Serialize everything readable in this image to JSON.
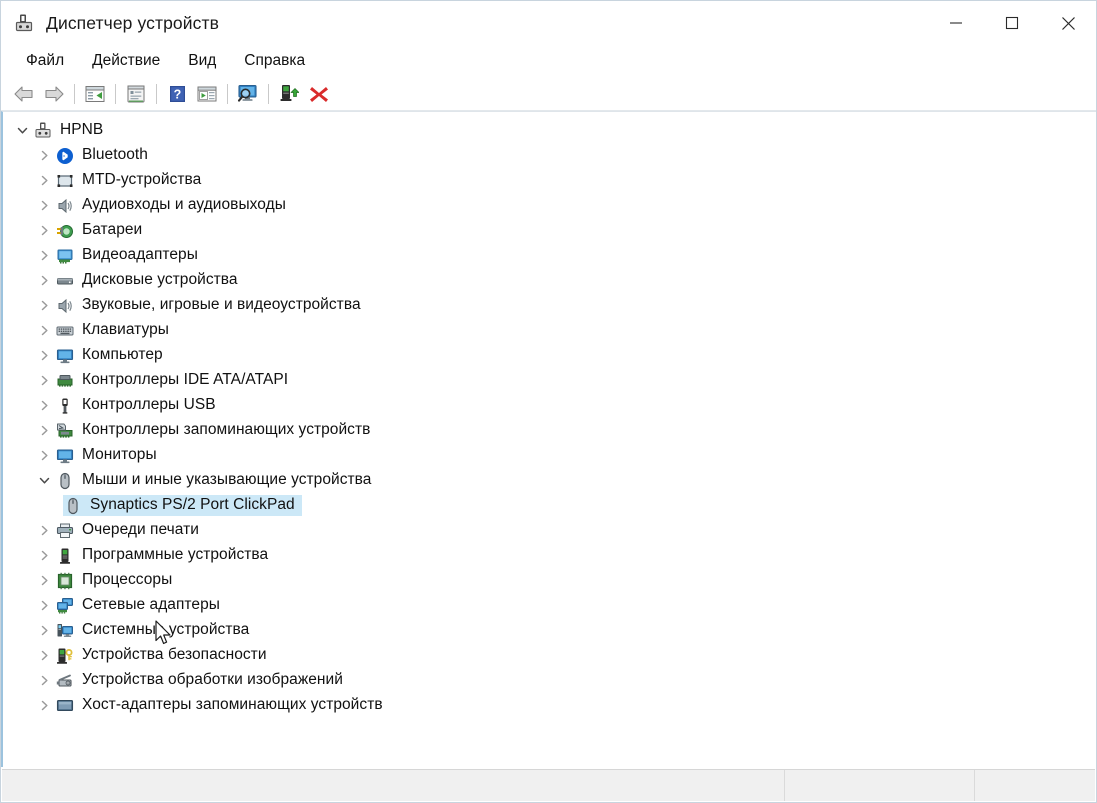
{
  "window": {
    "title": "Диспетчер устройств",
    "icon": "device-manager-icon",
    "minimize_label": "—",
    "maximize_label": "□",
    "close_label": "✕"
  },
  "menubar": {
    "items": [
      {
        "label": "Файл",
        "name": "menu-file"
      },
      {
        "label": "Действие",
        "name": "menu-action"
      },
      {
        "label": "Вид",
        "name": "menu-view"
      },
      {
        "label": "Справка",
        "name": "menu-help"
      }
    ]
  },
  "toolbar": {
    "buttons": [
      {
        "icon": "back-arrow-icon"
      },
      {
        "icon": "forward-arrow-icon"
      },
      {
        "icon": "properties-icon"
      },
      {
        "icon": "help-topics-icon"
      },
      {
        "icon": "help-icon"
      },
      {
        "icon": "run-icon"
      },
      {
        "icon": "scan-hardware-changes-icon"
      },
      {
        "icon": "update-driver-icon"
      },
      {
        "icon": "uninstall-device-icon"
      }
    ]
  },
  "tree": {
    "root": {
      "label": "HPNB",
      "icon": "computer-node-icon",
      "expanded": true,
      "depth": 0
    },
    "items": [
      {
        "label": "Bluetooth",
        "icon": "bluetooth-icon",
        "depth": 1,
        "expanded": false,
        "selected": false
      },
      {
        "label": "MTD-устройства",
        "icon": "mtd-device-icon",
        "depth": 1,
        "expanded": false,
        "selected": false
      },
      {
        "label": "Аудиовходы и аудиовыходы",
        "icon": "audio-io-icon",
        "depth": 1,
        "expanded": false,
        "selected": false
      },
      {
        "label": "Батареи",
        "icon": "battery-icon",
        "depth": 1,
        "expanded": false,
        "selected": false
      },
      {
        "label": "Видеоадаптеры",
        "icon": "display-adapter-icon",
        "depth": 1,
        "expanded": false,
        "selected": false
      },
      {
        "label": "Дисковые устройства",
        "icon": "disk-drive-icon",
        "depth": 1,
        "expanded": false,
        "selected": false
      },
      {
        "label": "Звуковые, игровые и видеоустройства",
        "icon": "sound-video-game-icon",
        "depth": 1,
        "expanded": false,
        "selected": false
      },
      {
        "label": "Клавиатуры",
        "icon": "keyboard-icon",
        "depth": 1,
        "expanded": false,
        "selected": false
      },
      {
        "label": "Компьютер",
        "icon": "computer-icon",
        "depth": 1,
        "expanded": false,
        "selected": false
      },
      {
        "label": "Контроллеры IDE ATA/ATAPI",
        "icon": "ide-controller-icon",
        "depth": 1,
        "expanded": false,
        "selected": false
      },
      {
        "label": "Контроллеры USB",
        "icon": "usb-controller-icon",
        "depth": 1,
        "expanded": false,
        "selected": false
      },
      {
        "label": "Контроллеры запоминающих устройств",
        "icon": "storage-controller-icon",
        "depth": 1,
        "expanded": false,
        "selected": false
      },
      {
        "label": "Мониторы",
        "icon": "monitor-icon",
        "depth": 1,
        "expanded": false,
        "selected": false
      },
      {
        "label": "Мыши и иные указывающие устройства",
        "icon": "mouse-icon",
        "depth": 1,
        "expanded": true,
        "selected": false
      },
      {
        "label": "Synaptics PS/2 Port ClickPad",
        "icon": "mouse-icon",
        "depth": 2,
        "expanded": null,
        "selected": true
      },
      {
        "label": "Очереди печати",
        "icon": "printer-icon",
        "depth": 1,
        "expanded": false,
        "selected": false
      },
      {
        "label": "Программные устройства",
        "icon": "software-device-icon",
        "depth": 1,
        "expanded": false,
        "selected": false
      },
      {
        "label": "Процессоры",
        "icon": "processor-icon",
        "depth": 1,
        "expanded": false,
        "selected": false
      },
      {
        "label": "Сетевые адаптеры",
        "icon": "network-adapter-icon",
        "depth": 1,
        "expanded": false,
        "selected": false
      },
      {
        "label": "Системные устройства",
        "icon": "system-device-icon",
        "depth": 1,
        "expanded": false,
        "selected": false
      },
      {
        "label": "Устройства безопасности",
        "icon": "security-device-icon",
        "depth": 1,
        "expanded": false,
        "selected": false
      },
      {
        "label": "Устройства обработки изображений",
        "icon": "imaging-device-icon",
        "depth": 1,
        "expanded": false,
        "selected": false
      },
      {
        "label": "Хост-адаптеры запоминающих устройств",
        "icon": "storage-host-icon",
        "depth": 1,
        "expanded": false,
        "selected": false
      }
    ]
  },
  "statusbar": {
    "main": "",
    "middle": "",
    "right": ""
  },
  "colors": {
    "selection": "#cce8f7",
    "accent_border": "#9cc3de",
    "text": "#111111",
    "close_hover": "#e81123"
  }
}
